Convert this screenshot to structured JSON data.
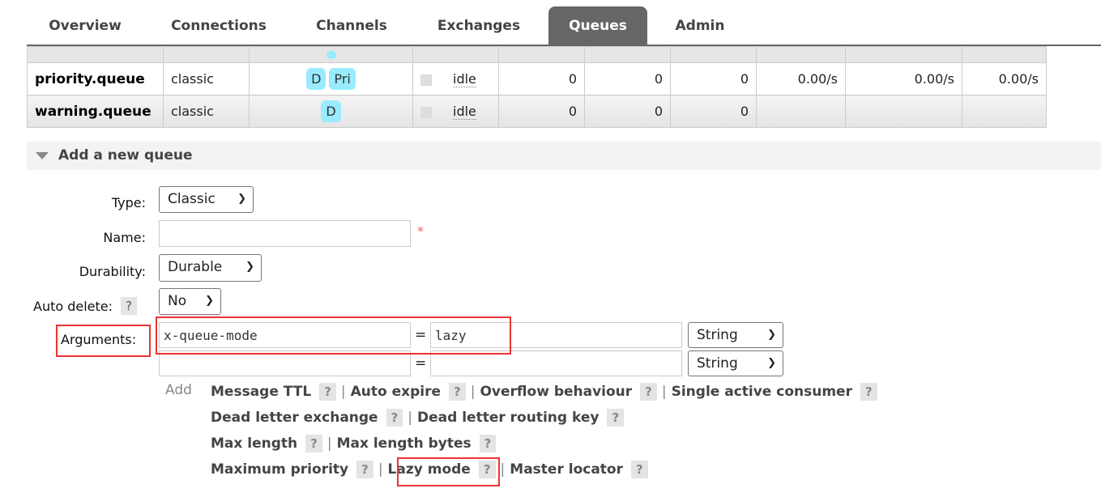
{
  "nav": {
    "tabs": [
      {
        "label": "Overview"
      },
      {
        "label": "Connections"
      },
      {
        "label": "Channels"
      },
      {
        "label": "Exchanges"
      },
      {
        "label": "Queues",
        "active": true
      },
      {
        "label": "Admin"
      }
    ]
  },
  "queues": [
    {
      "name": "priority.queue",
      "type": "classic",
      "features": [
        "D",
        "Pri"
      ],
      "state": "idle",
      "ready": "0",
      "unacked": "0",
      "total": "0",
      "incoming": "0.00/s",
      "deliver": "0.00/s",
      "ack": "0.00/s"
    },
    {
      "name": "warning.queue",
      "type": "classic",
      "features": [
        "D"
      ],
      "state": "idle",
      "ready": "0",
      "unacked": "0",
      "total": "0",
      "incoming": "",
      "deliver": "",
      "ack": ""
    }
  ],
  "partial_row": {
    "features": [
      "D"
    ]
  },
  "add_queue": {
    "title": "Add a new queue",
    "type_label": "Type:",
    "type_value": "Classic",
    "name_label": "Name:",
    "name_value": "",
    "required": "*",
    "durability_label": "Durability:",
    "durability_value": "Durable",
    "auto_delete_label": "Auto delete:",
    "auto_delete_value": "No",
    "help": "?",
    "arguments_label": "Arguments:",
    "arguments": [
      {
        "key": "x-queue-mode",
        "value": "lazy",
        "type": "String"
      },
      {
        "key": "",
        "value": "",
        "type": "String"
      }
    ],
    "equals": "=",
    "add_label": "Add",
    "shortcuts": [
      [
        "Message TTL",
        "Auto expire",
        "Overflow behaviour",
        "Single active consumer"
      ],
      [
        "Dead letter exchange",
        "Dead letter routing key"
      ],
      [
        "Max length",
        "Max length bytes"
      ],
      [
        "Maximum priority",
        "Lazy mode",
        "Master locator"
      ]
    ]
  },
  "colors": {
    "active_tab": "#666666",
    "badge": "#99ebff",
    "highlight": "#e33333"
  }
}
